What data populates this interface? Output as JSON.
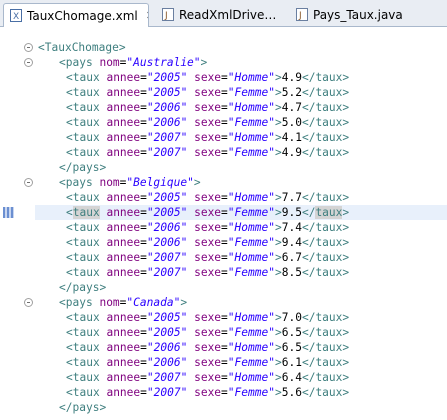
{
  "tabs": [
    {
      "label": "TauxChomage.xml",
      "close": "✕",
      "icon": "xml-file-icon",
      "active": true
    },
    {
      "label": "ReadXmlDrive…",
      "icon": "java-file-icon"
    },
    {
      "label": "Pays_Taux.java",
      "icon": "java-class-icon"
    }
  ],
  "root": "TauxChomage",
  "pays_tag": "pays",
  "taux_tag": "taux",
  "attr_nom": "nom",
  "attr_annee": "annee",
  "attr_sexe": "sexe",
  "countries": [
    {
      "nom": "Australie",
      "rows": [
        {
          "annee": "2005",
          "sexe": "Homme",
          "value": "4.9"
        },
        {
          "annee": "2005",
          "sexe": "Femme",
          "value": "5.2"
        },
        {
          "annee": "2006",
          "sexe": "Homme",
          "value": "4.7"
        },
        {
          "annee": "2006",
          "sexe": "Femme",
          "value": "5.0"
        },
        {
          "annee": "2007",
          "sexe": "Homme",
          "value": "4.1"
        },
        {
          "annee": "2007",
          "sexe": "Femme",
          "value": "4.9"
        }
      ]
    },
    {
      "nom": "Belgique",
      "rows": [
        {
          "annee": "2005",
          "sexe": "Homme",
          "value": "7.7"
        },
        {
          "annee": "2005",
          "sexe": "Femme",
          "value": "9.5"
        },
        {
          "annee": "2006",
          "sexe": "Homme",
          "value": "7.4"
        },
        {
          "annee": "2006",
          "sexe": "Femme",
          "value": "9.4"
        },
        {
          "annee": "2007",
          "sexe": "Homme",
          "value": "6.7"
        },
        {
          "annee": "2007",
          "sexe": "Femme",
          "value": "8.5"
        }
      ]
    },
    {
      "nom": "Canada",
      "rows": [
        {
          "annee": "2005",
          "sexe": "Homme",
          "value": "7.0"
        },
        {
          "annee": "2005",
          "sexe": "Femme",
          "value": "6.5"
        },
        {
          "annee": "2006",
          "sexe": "Homme",
          "value": "6.5"
        },
        {
          "annee": "2006",
          "sexe": "Femme",
          "value": "6.1"
        },
        {
          "annee": "2007",
          "sexe": "Homme",
          "value": "6.4"
        },
        {
          "annee": "2007",
          "sexe": "Femme",
          "value": "5.6"
        }
      ]
    }
  ],
  "highlighted": {
    "country": 1,
    "row": 1
  }
}
